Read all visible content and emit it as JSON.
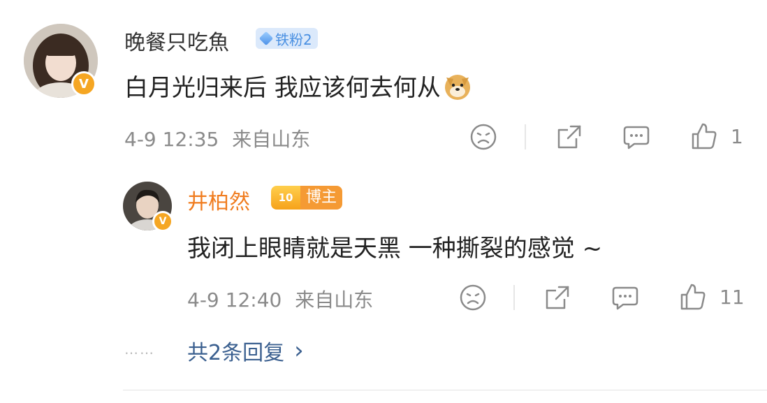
{
  "comment": {
    "username": "晚餐只吃魚",
    "fan_badge": "铁粉2",
    "text": "白月光归来后 我应该何去何从",
    "emoji_icon": "doge-emoji-icon",
    "time": "4-9 12:35",
    "location": "来自山东",
    "like_count": "1"
  },
  "reply": {
    "username": "井柏然",
    "badge_level": "10",
    "badge_label": "博主",
    "text": "我闭上眼睛就是天黑 一种撕裂的感觉 ~",
    "time": "4-9 12:40",
    "location": "来自山东",
    "like_count": "11"
  },
  "more_replies": {
    "dots": "……",
    "label": "共2条回复",
    "chevron": "›"
  },
  "colors": {
    "username_gray": "#333333",
    "username_orange": "#f07c1f",
    "link_blue": "#3a5f8f",
    "meta_gray": "#8a8a8a",
    "verified_gold": "#f5a623"
  }
}
